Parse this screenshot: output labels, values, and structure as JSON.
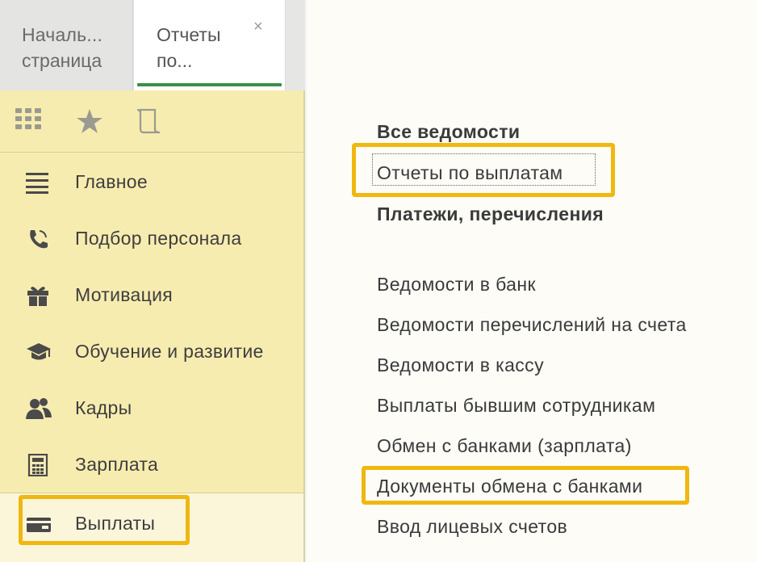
{
  "tabs": [
    {
      "line1": "Началь...",
      "line2": "страница"
    },
    {
      "line1": "Отчеты",
      "line2": "по...",
      "close": "×"
    }
  ],
  "toolbar_icons": [
    "apps-grid-icon",
    "star-icon",
    "history-scroll-icon"
  ],
  "sidebar": {
    "items": [
      {
        "label": "Главное",
        "icon": "menu-lines-icon"
      },
      {
        "label": "Подбор персонала",
        "icon": "phone-icon"
      },
      {
        "label": "Мотивация",
        "icon": "gift-icon"
      },
      {
        "label": "Обучение и развитие",
        "icon": "graduation-cap-icon"
      },
      {
        "label": "Кадры",
        "icon": "people-icon"
      },
      {
        "label": "Зарплата",
        "icon": "calculator-icon"
      },
      {
        "label": "Выплаты",
        "icon": "wallet-icon"
      }
    ],
    "active": "Выплаты"
  },
  "menu": {
    "group1": [
      "Все ведомости",
      "Отчеты по выплатам",
      "Платежи, перечисления"
    ],
    "group2": [
      "Ведомости в банк",
      "Ведомости перечислений на счета",
      "Ведомости в кассу",
      "Выплаты бывшим сотрудникам",
      "Обмен с банками (зарплата)",
      "Документы обмена с банками",
      "Ввод лицевых счетов"
    ]
  },
  "colors": {
    "panel_bg": "#f7ecb0",
    "highlight": "#f0b70f",
    "tab_underline": "#3a8f4a"
  }
}
